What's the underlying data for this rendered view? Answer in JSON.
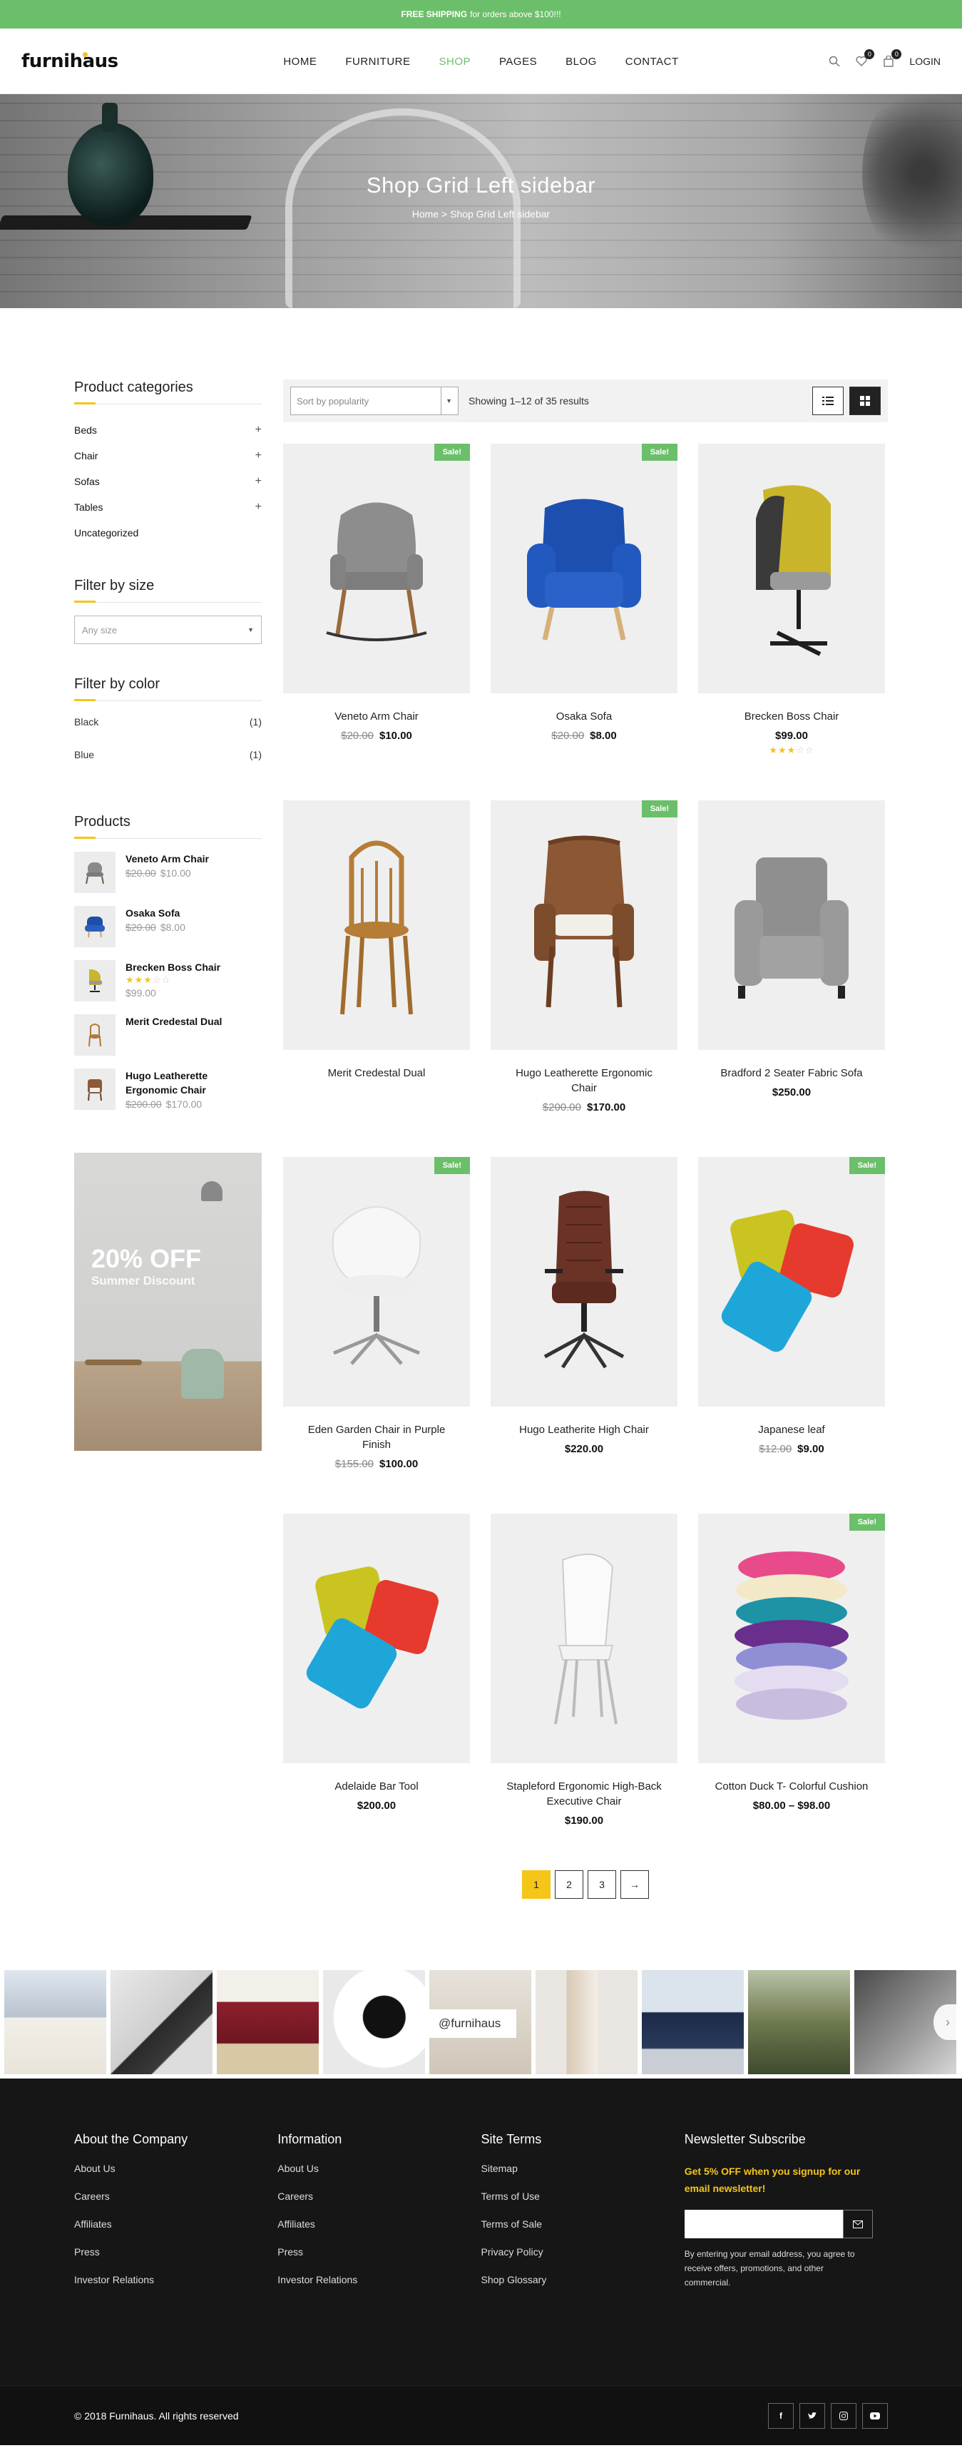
{
  "topbar": {
    "bold": "FREE SHIPPING",
    "text": "for orders above $100!!!"
  },
  "header": {
    "logo": "furnihaus",
    "nav": [
      "HOME",
      "FURNITURE",
      "SHOP",
      "PAGES",
      "BLOG",
      "CONTACT"
    ],
    "active_nav": "SHOP",
    "wishlist_count": "0",
    "cart_count": "0",
    "login": "LOGIN"
  },
  "hero": {
    "title": "Shop Grid Left sidebar",
    "breadcrumb_home": "Home",
    "breadcrumb_sep": ">",
    "breadcrumb_current": "Shop Grid Left sidebar"
  },
  "sidebar": {
    "categories_title": "Product categories",
    "categories": [
      {
        "label": "Beds",
        "expand": "+"
      },
      {
        "label": "Chair",
        "expand": "+"
      },
      {
        "label": "Sofas",
        "expand": "+"
      },
      {
        "label": "Tables",
        "expand": "+"
      },
      {
        "label": "Uncategorized",
        "expand": ""
      }
    ],
    "size_title": "Filter by size",
    "size_placeholder": "Any size",
    "color_title": "Filter by color",
    "colors": [
      {
        "label": "Black",
        "count": "(1)"
      },
      {
        "label": "Blue",
        "count": "(1)"
      }
    ],
    "products_title": "Products",
    "products": [
      {
        "name": "Veneto Arm Chair",
        "old": "$20.00",
        "price": "$10.00",
        "rating": 0
      },
      {
        "name": "Osaka Sofa",
        "old": "$20.00",
        "price": "$8.00",
        "rating": 0
      },
      {
        "name": "Brecken Boss Chair",
        "old": "",
        "price": "$99.00",
        "rating": 3
      },
      {
        "name": "Merit Credestal Dual",
        "old": "",
        "price": "",
        "rating": 0
      },
      {
        "name": "Hugo Leatherette Ergonomic Chair",
        "old": "$200.00",
        "price": "$170.00",
        "rating": 0
      }
    ],
    "banner_title": "20% OFF",
    "banner_sub": "Summer Discount"
  },
  "toolbar": {
    "sort": "Sort by popularity",
    "result": "Showing 1–12 of 35 results"
  },
  "sale_label": "Sale!",
  "products": [
    {
      "name": "Veneto Arm Chair",
      "old": "$20.00",
      "price": "$10.00",
      "sale": true,
      "rating": 0
    },
    {
      "name": "Osaka Sofa",
      "old": "$20.00",
      "price": "$8.00",
      "sale": true,
      "rating": 0
    },
    {
      "name": "Brecken Boss Chair",
      "old": "",
      "price": "$99.00",
      "sale": false,
      "rating": 3
    },
    {
      "name": "Merit Credestal Dual",
      "old": "",
      "price": "",
      "sale": false,
      "rating": 0
    },
    {
      "name": "Hugo Leatherette Ergonomic Chair",
      "old": "$200.00",
      "price": "$170.00",
      "sale": true,
      "rating": 0
    },
    {
      "name": "Bradford 2 Seater Fabric Sofa",
      "old": "",
      "price": "$250.00",
      "sale": false,
      "rating": 0
    },
    {
      "name": "Eden Garden Chair in Purple Finish",
      "old": "$155.00",
      "price": "$100.00",
      "sale": true,
      "rating": 0
    },
    {
      "name": "Hugo Leatherite High Chair",
      "old": "",
      "price": "$220.00",
      "sale": false,
      "rating": 0
    },
    {
      "name": "Japanese leaf",
      "old": "$12.00",
      "price": "$9.00",
      "sale": true,
      "rating": 0
    },
    {
      "name": "Adelaide Bar Tool",
      "old": "",
      "price": "$200.00",
      "sale": false,
      "rating": 0
    },
    {
      "name": "Stapleford Ergonomic High-Back Executive Chair",
      "old": "",
      "price": "$190.00",
      "sale": false,
      "rating": 0
    },
    {
      "name": "Cotton Duck T- Colorful Cushion",
      "old": "",
      "price": "$80.00 – $98.00",
      "sale": true,
      "rating": 0
    }
  ],
  "pagination": [
    "1",
    "2",
    "3",
    "→"
  ],
  "instagram_tag": "@furnihaus",
  "footer": {
    "cols": [
      {
        "title": "About the Company",
        "links": [
          "About Us",
          "Careers",
          "Affiliates",
          "Press",
          "Investor Relations"
        ]
      },
      {
        "title": "Information",
        "links": [
          "About Us",
          "Careers",
          "Affiliates",
          "Press",
          "Investor Relations"
        ]
      },
      {
        "title": "Site Terms",
        "links": [
          "Sitemap",
          "Terms of Use",
          "Terms of Sale",
          "Privacy Policy",
          "Shop Glossary"
        ]
      }
    ],
    "newsletter_title": "Newsletter Subscribe",
    "newsletter_lead": "Get 5% OFF when you signup for our email newsletter!",
    "newsletter_note": "By entering your email address, you agree to receive offers, promotions, and other commercial.",
    "copyright": "© 2018 Furnihaus. All rights reserved",
    "social": [
      "f",
      "t",
      "ig",
      "yt"
    ]
  },
  "colors": {
    "accent": "#6cbf6a",
    "highlight": "#f5c518",
    "footer_bg": "#161616"
  }
}
